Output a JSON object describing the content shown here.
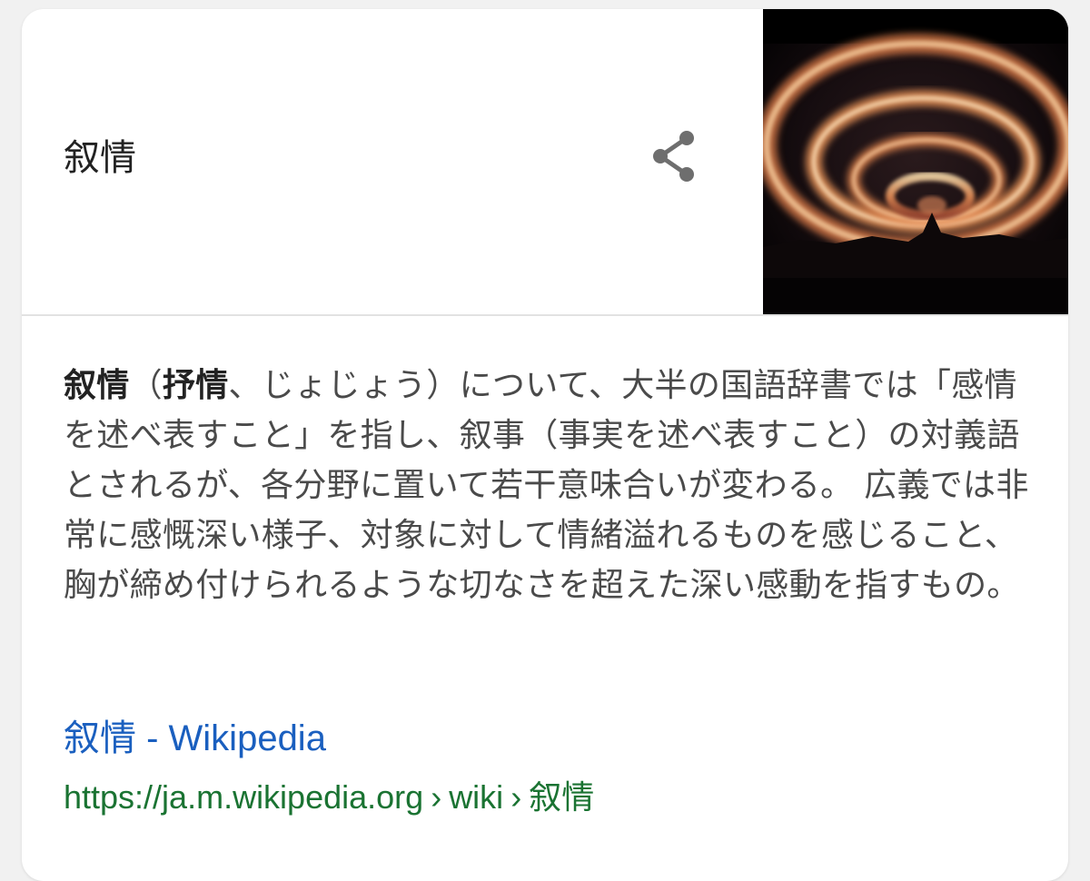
{
  "panel": {
    "title": "叙情",
    "share_icon": "share-icon",
    "image_icon": "aurora-spiral-image"
  },
  "description": {
    "lead_bold": "叙情",
    "paren_open": "（",
    "alt_bold": "抒情",
    "rest": "、じょじょう）について、大半の国語辞書では「感情を述べ表すこと」を指し、叙事（事実を述べ表すこと）の対義語とされるが、各分野に置いて若干意味合いが変わる。 広義では非常に感慨深い様子、対象に対して情緒溢れるものを感じること、胸が締め付けられるような切なさを超えた深い感動を指すもの。"
  },
  "source": {
    "link_text": "叙情 - Wikipedia",
    "url_host": "https://ja.m.wikipedia.org",
    "url_sep": "›",
    "url_path1": "wiki",
    "url_path2": "叙情"
  },
  "colors": {
    "link": "#1a5fbf",
    "url": "#1a7332",
    "text": "#4a4a4a"
  }
}
